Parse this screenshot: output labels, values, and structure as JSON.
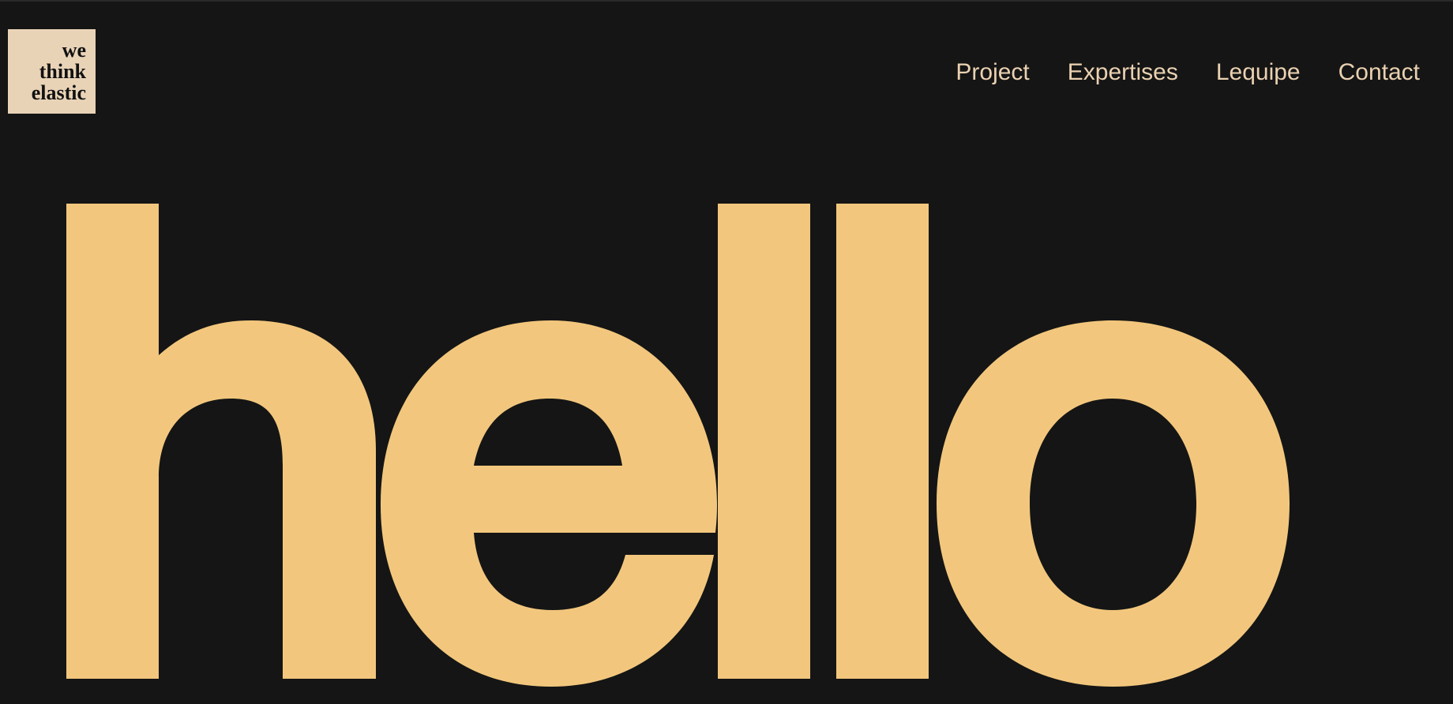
{
  "brand": {
    "logo_lines": [
      "we",
      "think",
      "elastic"
    ]
  },
  "nav": {
    "items": [
      {
        "label": "Project"
      },
      {
        "label": "Expertises"
      },
      {
        "label": "Lequipe"
      },
      {
        "label": "Contact"
      }
    ]
  },
  "hero": {
    "headline": "hello"
  },
  "colors": {
    "background": "#151515",
    "accent": "#f2c77d",
    "nav_text": "#ead1b1",
    "logo_bg": "#e9d3b7",
    "logo_text": "#111111"
  }
}
